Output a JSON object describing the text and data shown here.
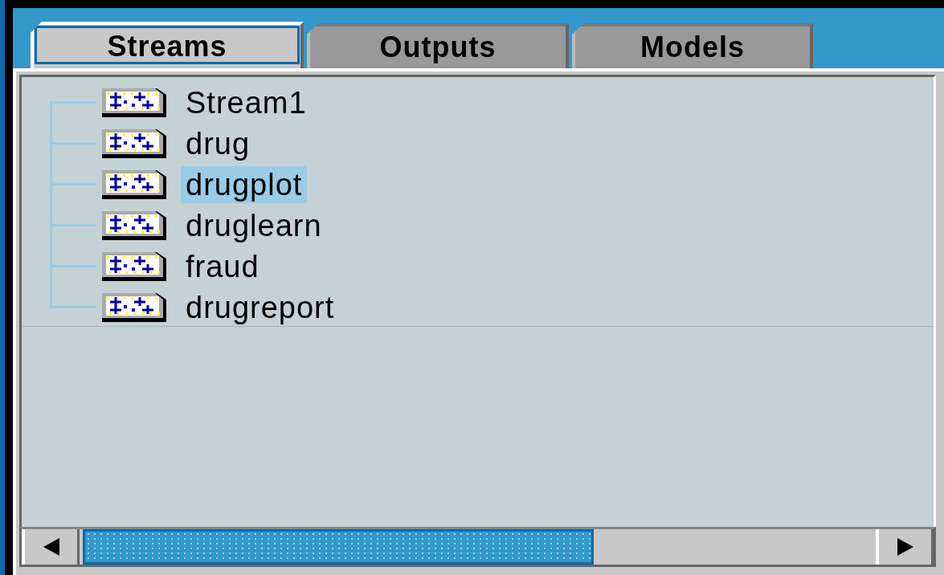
{
  "tabs": [
    {
      "label": "Streams",
      "selected": true
    },
    {
      "label": "Outputs",
      "selected": false
    },
    {
      "label": "Models",
      "selected": false
    }
  ],
  "tree": {
    "items": [
      {
        "label": "Stream1",
        "selected": false
      },
      {
        "label": "drug",
        "selected": false
      },
      {
        "label": "drugplot",
        "selected": true
      },
      {
        "label": "druglearn",
        "selected": false
      },
      {
        "label": "fraud",
        "selected": false
      },
      {
        "label": "drugreport",
        "selected": false
      }
    ]
  }
}
